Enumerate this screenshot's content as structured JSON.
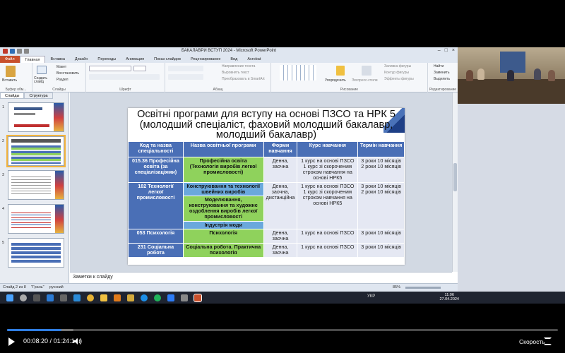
{
  "player": {
    "current_time": "00:08:20",
    "separator": " / ",
    "duration": "01:24:14",
    "speed_label": "Скорость",
    "progress_fraction": 0.099,
    "buffered_fraction": 0.12
  },
  "ppt": {
    "window_title": "БАКАЛАВРИ ВСТУП 2024 - Microsoft PowerPoint",
    "tabs": [
      "Файл",
      "Главная",
      "Вставка",
      "Дизайн",
      "Переходы",
      "Анимация",
      "Показ слайдов",
      "Рецензирование",
      "Вид",
      "Acrobat"
    ],
    "ribbon": {
      "paste": "Вставить",
      "clipboard_group": "Буфер обм...",
      "create_slide": "Создать слайд",
      "layout": "Макет",
      "reset": "Восстановить",
      "section": "Раздел",
      "slides_group": "Слайды",
      "font_group": "Шрифт",
      "paragraph_group": "Абзац",
      "text_direction": "Направление текста",
      "align_text": "Выровнять текст",
      "smartart": "Преобразовать в SmartArt",
      "arrange": "Упорядочить",
      "quick_styles": "Экспресс-стили",
      "fill": "Заливка фигуры",
      "outline": "Контур фигуры",
      "effects": "Эффекты фигуры",
      "drawing_group": "Рисование",
      "find": "Найти",
      "replace": "Заменить",
      "select": "Выделить",
      "editing_group": "Редактирование"
    },
    "left_tabs": [
      "Слайды",
      "Структура"
    ],
    "thumb_numbers": [
      "1",
      "2",
      "3",
      "4",
      "5"
    ],
    "notes_placeholder": "Заметки к слайду",
    "status": {
      "slide": "Слайд 2 из 8",
      "theme": "\"Грань\"",
      "language": "русский",
      "zoom": "85%"
    }
  },
  "slide": {
    "title_line1": "Освітні програми для вступу на основі ПЗСО та НРК 5",
    "title_line2": "(молодший спеціаліст, фаховий молодший бакалавр,",
    "title_line3": "молодший бакалавр)",
    "headers": [
      "Код та назва спеціальності",
      "Назва освітньої програми",
      "Форми навчання",
      "Курс навчання",
      "Термін навчання"
    ],
    "rows": [
      {
        "code": "015.36 Професійна освіта (за спеціалізаціями)",
        "program": "Професійна освіта (Технологія виробів легкої промисловості)",
        "form": "Денна, заочна",
        "course": "1 курс на основі ПЗСО\n1 курс зі скороченим строком навчання на основі НРК5",
        "term": "3 роки 10 місяців\n2 роки 10 місяців"
      },
      {
        "code": "182 Технології легкої промисловості",
        "programs": [
          "Конструювання та технології швейних виробів",
          "Моделювання, конструювання та художнє оздоблення виробів легкої промисловості",
          "Індустрія моди"
        ],
        "form": "Денна, заочна, дистанційна",
        "course": "1 курс на основі ПЗСО\n1 курс зі скороченим строком навчання на основі НРК5",
        "term": "3 роки 10 місяців\n2 роки 10 місяців"
      },
      {
        "code": "053 Психологія",
        "program": "Психологія",
        "form": "Денна, заочна",
        "course": "1 курс на основі ПЗСО",
        "term": "3 роки 10 місяців"
      },
      {
        "code": "231 Соціальна робота",
        "program": "Соціальна робота. Практична психологія",
        "form": "Денна, заочна",
        "course": "1 курс на основі ПЗСО",
        "term": "3 роки 10 місяців"
      }
    ]
  },
  "taskbar": {
    "lang": "УКР",
    "time": "11:06",
    "date": "27.04.2024"
  },
  "colors": {
    "accent": "#2f7de1",
    "table_header": "#4a6fb6",
    "green": "#8fd25c",
    "blue": "#6aa8dc"
  }
}
